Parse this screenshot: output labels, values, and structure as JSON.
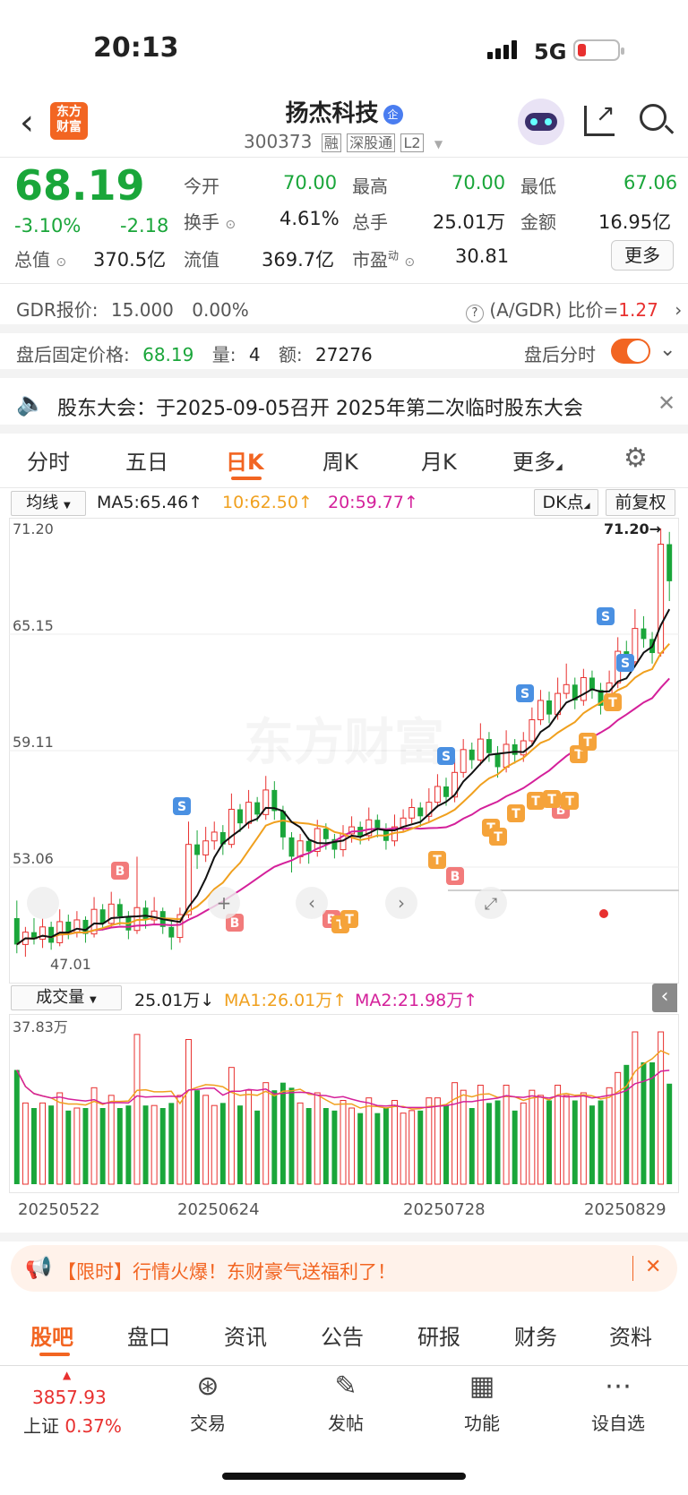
{
  "status_bar": {
    "time": "20:13",
    "network": "5G"
  },
  "header": {
    "stock_name": "扬杰科技",
    "badge": "企",
    "code": "300373",
    "tags": [
      "融",
      "深股通",
      "L2"
    ]
  },
  "quote": {
    "price": "68.19",
    "change_pct": "-3.10%",
    "change": "-2.18",
    "today_open_label": "今开",
    "today_open": "70.00",
    "high_label": "最高",
    "high": "70.00",
    "low_label": "最低",
    "low": "67.06",
    "turnover_label": "换手",
    "turnover": "4.61%",
    "volume_label": "总手",
    "volume": "25.01万",
    "amount_label": "金额",
    "amount": "16.95亿",
    "mktcap_label": "总值",
    "mktcap": "370.5亿",
    "float_label": "流值",
    "float_cap": "369.7亿",
    "pe_label": "市盈",
    "pe_sup": "动",
    "pe": "30.81",
    "more": "更多"
  },
  "gdr": {
    "label": "GDR报价:",
    "price": "15.000",
    "pct": "0.00%",
    "ratio_label": "(A/GDR) 比价=",
    "ratio": "1.27"
  },
  "after_hours": {
    "label": "盘后固定价格:",
    "price": "68.19",
    "qty_label": "量:",
    "qty": "4",
    "amt_label": "额:",
    "amt": "27276",
    "toggle_label": "盘后分时"
  },
  "notice": {
    "text": "股东大会：于2025-09-05召开 2025年第二次临时股东大会"
  },
  "tabs": [
    "分时",
    "五日",
    "日K",
    "周K",
    "月K",
    "更多"
  ],
  "active_tab": "日K",
  "kline_toolbar": {
    "indicator": "均线",
    "ma5": "MA5:65.46↑",
    "ma10": "10:62.50↑",
    "ma20": "20:59.77↑",
    "dk": "DK点",
    "adjust": "前复权"
  },
  "price_axis": [
    "71.20",
    "65.15",
    "59.11",
    "53.06"
  ],
  "price_min_label": "47.01",
  "max_marker": "71.20→",
  "watermark": "东方财富",
  "volume_toolbar": {
    "indicator": "成交量",
    "vol": "25.01万↓",
    "ma1": "MA1:26.01万↑",
    "ma2": "MA2:21.98万↑"
  },
  "volume_axis": "37.83万",
  "dates": [
    "20250522",
    "20250624",
    "20250728",
    "20250829"
  ],
  "colors": {
    "up": "#e8302f",
    "down": "#1aa63a",
    "ma5": "#111111",
    "ma10": "#f0a01e",
    "ma20": "#d4209a",
    "accent": "#f26522"
  },
  "chart_data": {
    "type": "candlestick",
    "candles": [
      [
        49,
        47.5,
        50,
        47
      ],
      [
        47.5,
        48.2,
        48.5,
        46.8
      ],
      [
        48.2,
        47.8,
        49,
        47.5
      ],
      [
        47.8,
        48.5,
        49,
        47.3
      ],
      [
        48.5,
        47.6,
        48.8,
        47.2
      ],
      [
        47.6,
        48.8,
        49.5,
        47.4
      ],
      [
        48.8,
        48.2,
        49.2,
        47.8
      ],
      [
        48.2,
        48.9,
        49.4,
        47.9
      ],
      [
        48.9,
        48.1,
        49.1,
        47.6
      ],
      [
        48.1,
        49.5,
        50.2,
        47.9
      ],
      [
        49.5,
        48.7,
        49.8,
        48.3
      ],
      [
        48.7,
        49.8,
        50.5,
        48.5
      ],
      [
        49.8,
        49.1,
        50.1,
        48.6
      ],
      [
        49.1,
        48.3,
        49.4,
        47.8
      ],
      [
        48.3,
        49.6,
        52.5,
        48.1
      ],
      [
        49.6,
        48.9,
        50,
        48.4
      ],
      [
        48.9,
        49.4,
        50.2,
        48.6
      ],
      [
        49.4,
        48.5,
        49.6,
        48.1
      ],
      [
        48.5,
        47.9,
        48.9,
        47.2
      ],
      [
        47.9,
        49.2,
        49.6,
        47.6
      ],
      [
        49.2,
        53.2,
        54.5,
        49
      ],
      [
        53.2,
        52.6,
        54,
        51.8
      ],
      [
        52.6,
        53.4,
        54.2,
        52.2
      ],
      [
        53.4,
        53.9,
        54.5,
        52.9
      ],
      [
        53.9,
        53.2,
        54.3,
        52.6
      ],
      [
        53.2,
        55.2,
        56.1,
        53
      ],
      [
        55.2,
        54.4,
        55.5,
        53.9
      ],
      [
        54.4,
        55.6,
        56.3,
        54.1
      ],
      [
        55.6,
        54.9,
        55.9,
        54.5
      ],
      [
        54.9,
        56.3,
        57.1,
        54.6
      ],
      [
        56.3,
        55.1,
        56.8,
        54.6
      ],
      [
        55.1,
        53.6,
        55.4,
        52.9
      ],
      [
        53.6,
        52.5,
        53.9,
        51.6
      ],
      [
        52.5,
        53.4,
        53.8,
        52.1
      ],
      [
        53.4,
        52.8,
        53.6,
        52.1
      ],
      [
        52.8,
        54.1,
        54.6,
        52.5
      ],
      [
        54.1,
        53.5,
        54.4,
        52.9
      ],
      [
        53.5,
        52.9,
        53.8,
        52.4
      ],
      [
        52.9,
        53.8,
        54.3,
        52.5
      ],
      [
        53.8,
        54.2,
        54.8,
        53.3
      ],
      [
        54.2,
        53.7,
        54.5,
        53.2
      ],
      [
        53.7,
        54.6,
        55.3,
        53.4
      ],
      [
        54.6,
        54.1,
        54.9,
        53.6
      ],
      [
        54.1,
        53.4,
        54.4,
        52.9
      ],
      [
        53.4,
        54.2,
        54.9,
        53.1
      ],
      [
        54.2,
        54.7,
        55.2,
        53.9
      ],
      [
        54.7,
        55.3,
        55.8,
        54.4
      ],
      [
        55.3,
        54.8,
        55.6,
        54.2
      ],
      [
        54.8,
        55.6,
        56.4,
        54.5
      ],
      [
        55.6,
        56.5,
        57.2,
        55.3
      ],
      [
        56.5,
        55.9,
        57,
        55.4
      ],
      [
        55.9,
        57.3,
        58.1,
        55.6
      ],
      [
        57.3,
        58.6,
        59.2,
        57
      ],
      [
        58.6,
        58,
        59,
        57.5
      ],
      [
        58,
        59.2,
        60.1,
        57.7
      ],
      [
        59.2,
        58.4,
        59.6,
        57.9
      ],
      [
        58.4,
        57.6,
        58.8,
        57
      ],
      [
        57.6,
        58.9,
        59.7,
        57.3
      ],
      [
        58.9,
        58.3,
        59.2,
        57.8
      ],
      [
        58.3,
        59.1,
        59.6,
        57.9
      ],
      [
        59.1,
        60.3,
        61,
        58.8
      ],
      [
        60.3,
        61.4,
        62,
        60
      ],
      [
        61.4,
        60.6,
        61.9,
        60.1
      ],
      [
        60.6,
        61.8,
        62.7,
        60.3
      ],
      [
        61.8,
        62.3,
        63.5,
        61.5
      ],
      [
        62.3,
        61.4,
        62.7,
        60.9
      ],
      [
        61.4,
        62.7,
        63.2,
        61.1
      ],
      [
        62.7,
        62,
        63.1,
        61.5
      ],
      [
        62,
        61.1,
        62.4,
        60.6
      ],
      [
        61.1,
        62.4,
        63.1,
        60.8
      ],
      [
        62.4,
        64.2,
        65,
        62.1
      ],
      [
        64.2,
        63.6,
        64.8,
        63.1
      ],
      [
        63.6,
        65.5,
        66.6,
        63.3
      ],
      [
        65.5,
        64.9,
        66.2,
        64.4
      ],
      [
        64.9,
        64.1,
        65.3,
        63.5
      ],
      [
        64.1,
        70.3,
        71.2,
        63.9
      ],
      [
        70.3,
        68.19,
        71,
        67.06
      ]
    ]
  }
}
